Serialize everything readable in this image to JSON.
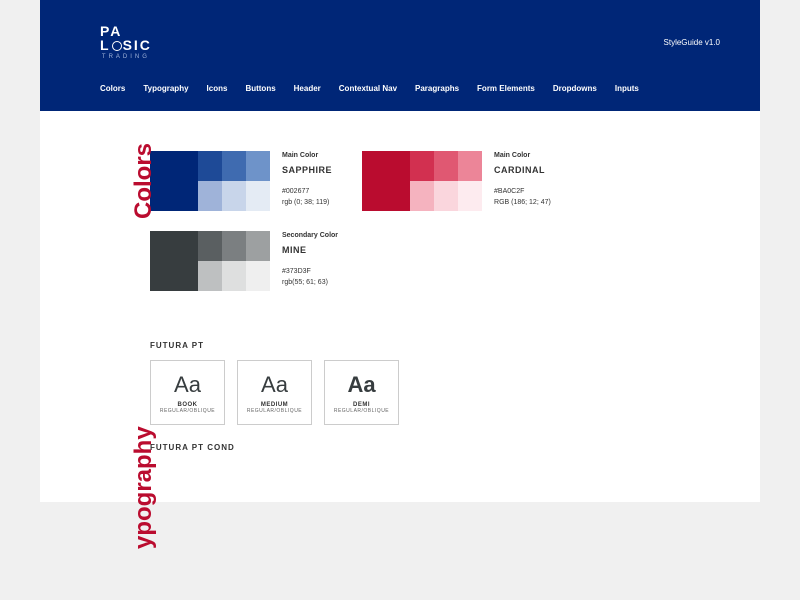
{
  "header": {
    "logo_top": "PA",
    "logo_bottom": "L  SIC",
    "logo_sub": "TRADING",
    "version": "StyleGuide v1.0"
  },
  "nav": {
    "items": [
      "Colors",
      "Typography",
      "Icons",
      "Buttons",
      "Header",
      "Contextual Nav",
      "Paragraphs",
      "Form Elements",
      "Dropdowns",
      "Inputs"
    ]
  },
  "sections": {
    "colors_label": "Colors",
    "typography_label": "ypography"
  },
  "colors": {
    "sapphire": {
      "role": "Main Color",
      "name": "SAPPHIRE",
      "hex": "#002677",
      "rgb": "rgb (0; 38; 119)",
      "swatches": [
        "#002677",
        "#1E4A97",
        "#3F6BB0",
        "#6E93C9",
        "#9FB3D9",
        "#C8D5EA",
        "#E4EBF4"
      ]
    },
    "cardinal": {
      "role": "Main Color",
      "name": "CARDINAL",
      "hex": "#BA0C2F",
      "rgb": "RGB (186; 12; 47)",
      "swatches": [
        "#BA0C2F",
        "#D23050",
        "#E05872",
        "#EC8598",
        "#F5B3BF",
        "#FAD6DD",
        "#FDEBEF"
      ]
    },
    "mine": {
      "role": "Secondary Color",
      "name": "MINE",
      "hex": "#373D3F",
      "rgb": "rgb(55; 61; 63)",
      "swatches": [
        "#373D3F",
        "#5A5F61",
        "#7B7F81",
        "#9DA0A1",
        "#BEC0C1",
        "#DEDFDF",
        "#EFEFEF"
      ]
    }
  },
  "typography": {
    "font1": "FUTURA PT",
    "font2": "FUTURA PT COND",
    "sample": "Aa",
    "weights": [
      {
        "name": "BOOK",
        "sub": "REGULAR/OBLIQUE"
      },
      {
        "name": "MEDIUM",
        "sub": "REGULAR/OBLIQUE"
      },
      {
        "name": "DEMI",
        "sub": "REGULAR/OBLIQUE"
      }
    ]
  }
}
